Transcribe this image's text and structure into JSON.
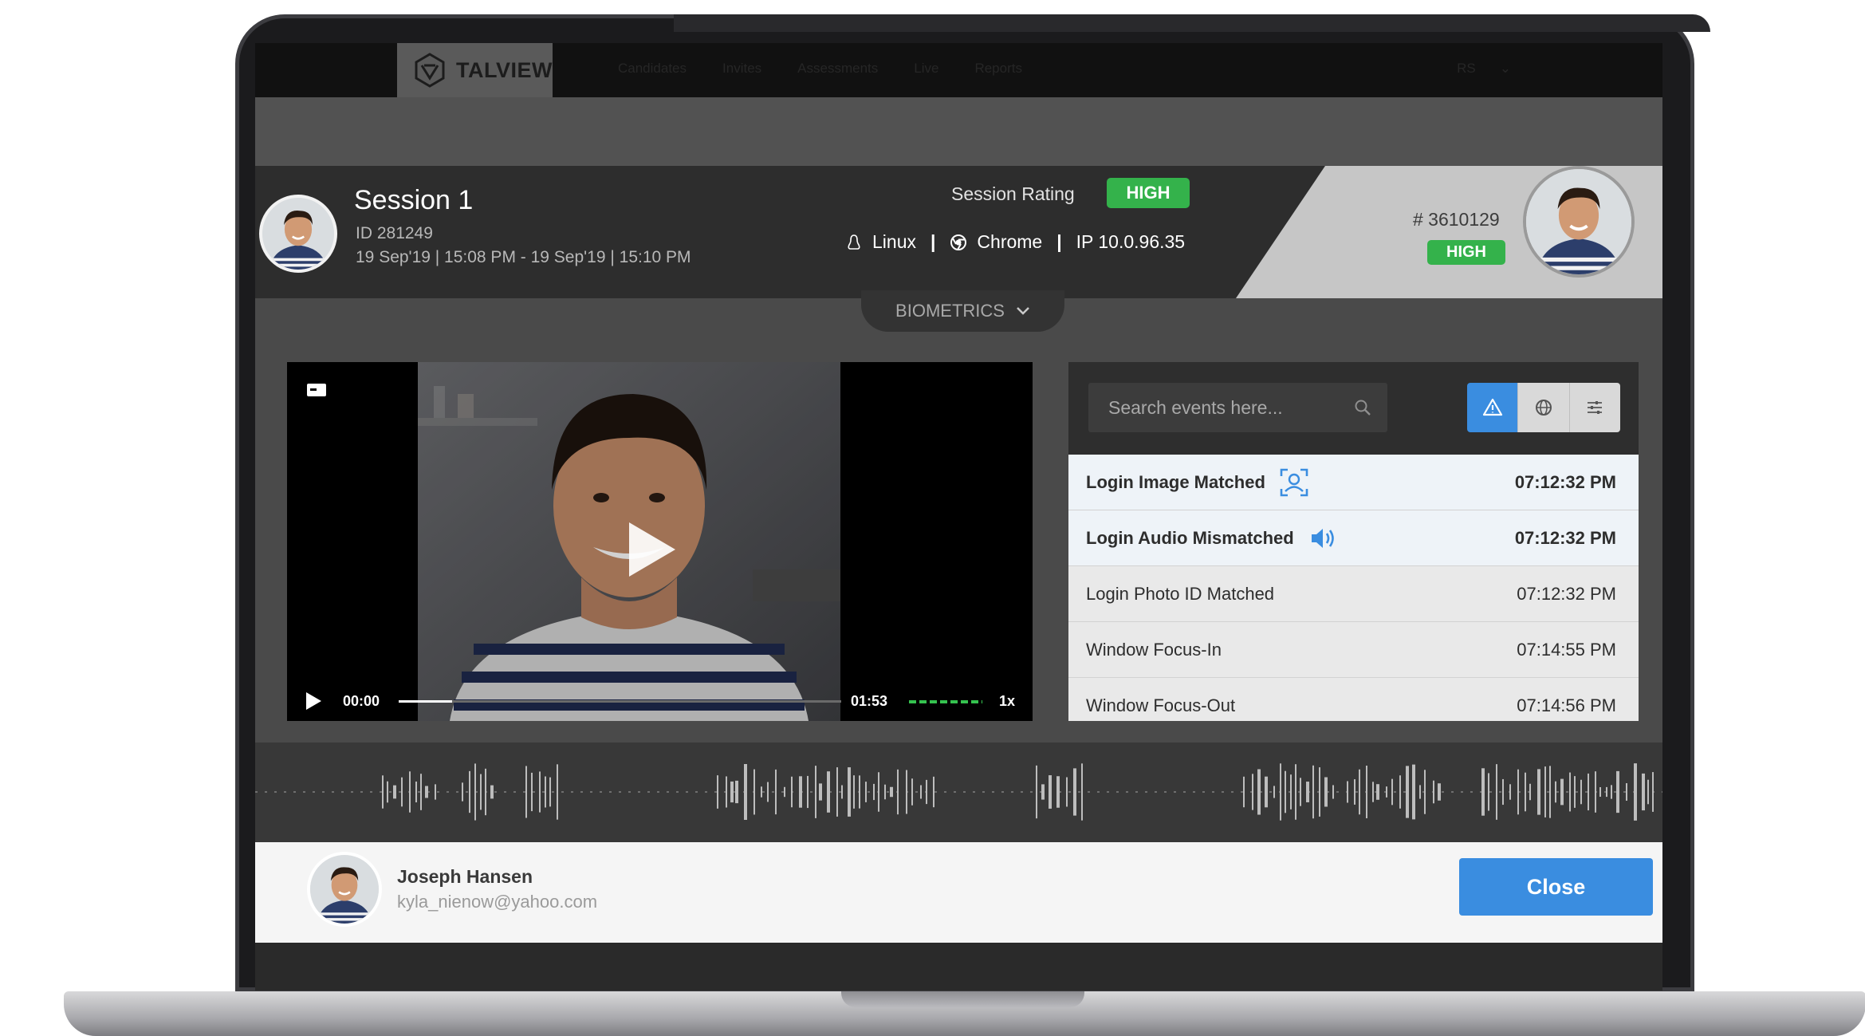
{
  "app": {
    "brand": "TALVIEW",
    "nav_links": [
      "Candidates",
      "Invites",
      "Assessments",
      "Live",
      "Reports"
    ],
    "nav_right": [
      "RS",
      "⌄"
    ]
  },
  "session": {
    "title": "Session 1",
    "id_text": "ID 281249",
    "dates": "19 Sep'19 | 15:08 PM - 19 Sep'19 | 15:10 PM",
    "rating_label": "Session Rating",
    "rating_badge": "HIGH",
    "os": "Linux",
    "browser": "Chrome",
    "ip": "IP 10.0.96.35",
    "separator": "|"
  },
  "candidate": {
    "id_text": "# 3610129",
    "badge": "HIGH"
  },
  "biometrics": {
    "label": "BIOMETRICS"
  },
  "player": {
    "current_time": "00:00",
    "total_time": "01:53",
    "speed": "1x",
    "progress": 0.12
  },
  "events": {
    "search_placeholder": "Search events here...",
    "filters": [
      "warning-icon",
      "globe-icon",
      "sliders-icon"
    ],
    "items": [
      {
        "name": "Login Image Matched",
        "time": "07:12:32 PM",
        "icon": "face-scan-icon"
      },
      {
        "name": "Login Audio Mismatched",
        "time": "07:12:32 PM",
        "icon": "speaker-icon"
      },
      {
        "name": "Login Photo ID Matched",
        "time": "07:12:32 PM",
        "icon": ""
      },
      {
        "name": "Window Focus-In",
        "time": "07:14:55 PM",
        "icon": ""
      },
      {
        "name": "Window Focus-Out",
        "time": "07:14:56 PM",
        "icon": ""
      }
    ]
  },
  "user": {
    "name": "Joseph Hansen",
    "email": "kyla_nienow@yahoo.com"
  },
  "footer": {
    "close_label": "Close"
  },
  "colors": {
    "accent": "#3a8de0",
    "badge_green": "#34b24b",
    "progress_green": "#35c24f"
  }
}
